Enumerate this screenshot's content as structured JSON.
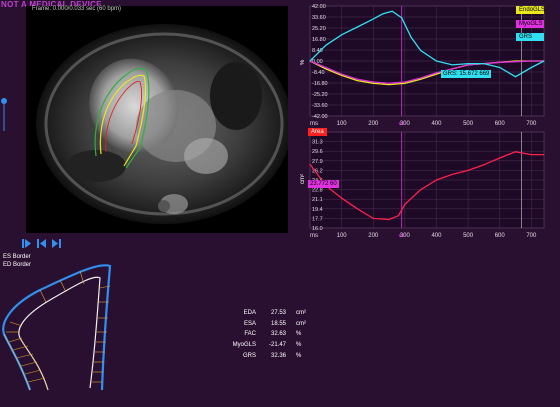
{
  "app": {
    "watermark": "NOT A MEDICAL DEVICE",
    "image_info": "Frame: 0.000/0.033 sec (60 bpm)"
  },
  "legend": {
    "endo": "EndoGLS",
    "myo": "MyoGLS",
    "grs": "GRS"
  },
  "strain_chart": {
    "ylabel": "%",
    "xlabel": "ms",
    "marker": "e3",
    "yticks": [
      "42.00",
      "33.60",
      "25.20",
      "16.80",
      "8.40",
      "0.00",
      "-8.40",
      "-16.80",
      "-25.20",
      "-33.60",
      "-42.00"
    ],
    "xticks": [
      "ms",
      "100",
      "200",
      "300",
      "400",
      "500",
      "600",
      "700"
    ],
    "cursor_label": "GRS: 15.672",
    "cursor_value": "669"
  },
  "area_chart": {
    "ylabel": "cm²",
    "xlabel": "ms",
    "marker": "e3",
    "tag": "Area",
    "yticks": [
      "33.0",
      "31.3",
      "29.6",
      "27.9",
      "26.2",
      "24.5",
      "22.8",
      "21.1",
      "19.4",
      "17.7",
      "16.0"
    ],
    "xticks": [
      "ms",
      "100",
      "200",
      "300",
      "400",
      "500",
      "600",
      "700"
    ],
    "cursor_label": "23.772",
    "cursor_value": "60"
  },
  "borders": {
    "es": "ES Border",
    "ed": "ED Border"
  },
  "metrics": [
    {
      "key": "EDA",
      "value": "27.53",
      "unit": "cm²"
    },
    {
      "key": "ESA",
      "value": "18.55",
      "unit": "cm²"
    },
    {
      "key": "FAC",
      "value": "32.63",
      "unit": "%"
    },
    {
      "key": "MyoGLS",
      "value": "-21.47",
      "unit": "%"
    },
    {
      "key": "GRS",
      "value": "32.36",
      "unit": "%"
    }
  ],
  "colors": {
    "background": "#2a1030",
    "endo": "#e8e81c",
    "myo": "#e030e0",
    "grs": "#30e0f0",
    "area": "#ff2050",
    "border_es": "#e8c870",
    "border_ed": "#3090f0"
  },
  "chart_data": [
    {
      "type": "line",
      "xlabel": "ms",
      "ylabel": "%",
      "ylim": [
        -42.0,
        42.0
      ],
      "xlim": [
        0,
        740
      ],
      "series": [
        {
          "name": "EndoGLS",
          "x": [
            0,
            50,
            100,
            150,
            200,
            250,
            300,
            350,
            400,
            450,
            500,
            550,
            600,
            650,
            700,
            740
          ],
          "values": [
            0,
            -6,
            -11,
            -15,
            -17,
            -18,
            -17,
            -14,
            -10,
            -6,
            -3,
            -2,
            -1,
            0,
            0,
            0
          ]
        },
        {
          "name": "MyoGLS",
          "x": [
            0,
            50,
            100,
            150,
            200,
            250,
            300,
            350,
            400,
            450,
            500,
            550,
            600,
            650,
            700,
            740
          ],
          "values": [
            0,
            -5,
            -10,
            -14,
            -16,
            -17,
            -16,
            -13,
            -9,
            -6,
            -3,
            -2,
            -1,
            -0.5,
            0,
            0
          ]
        },
        {
          "name": "GRS",
          "x": [
            0,
            50,
            100,
            150,
            200,
            230,
            260,
            290,
            320,
            350,
            400,
            450,
            500,
            550,
            600,
            650,
            700,
            740
          ],
          "values": [
            0,
            12,
            20,
            26,
            32,
            36,
            38,
            33,
            18,
            8,
            0,
            -3,
            -2,
            -2,
            -5,
            -12,
            -5,
            0
          ]
        }
      ]
    },
    {
      "type": "line",
      "xlabel": "ms",
      "ylabel": "cm²",
      "ylim": [
        16.0,
        33.0
      ],
      "xlim": [
        0,
        740
      ],
      "series": [
        {
          "name": "Area",
          "x": [
            0,
            50,
            100,
            150,
            200,
            250,
            280,
            300,
            350,
            400,
            450,
            500,
            550,
            600,
            650,
            700,
            740
          ],
          "values": [
            27.3,
            23.5,
            21.3,
            19.4,
            17.7,
            17.5,
            18.2,
            20.2,
            22.8,
            24.5,
            25.5,
            26.2,
            27.2,
            28.4,
            29.5,
            29.0,
            29.0
          ]
        }
      ]
    }
  ]
}
